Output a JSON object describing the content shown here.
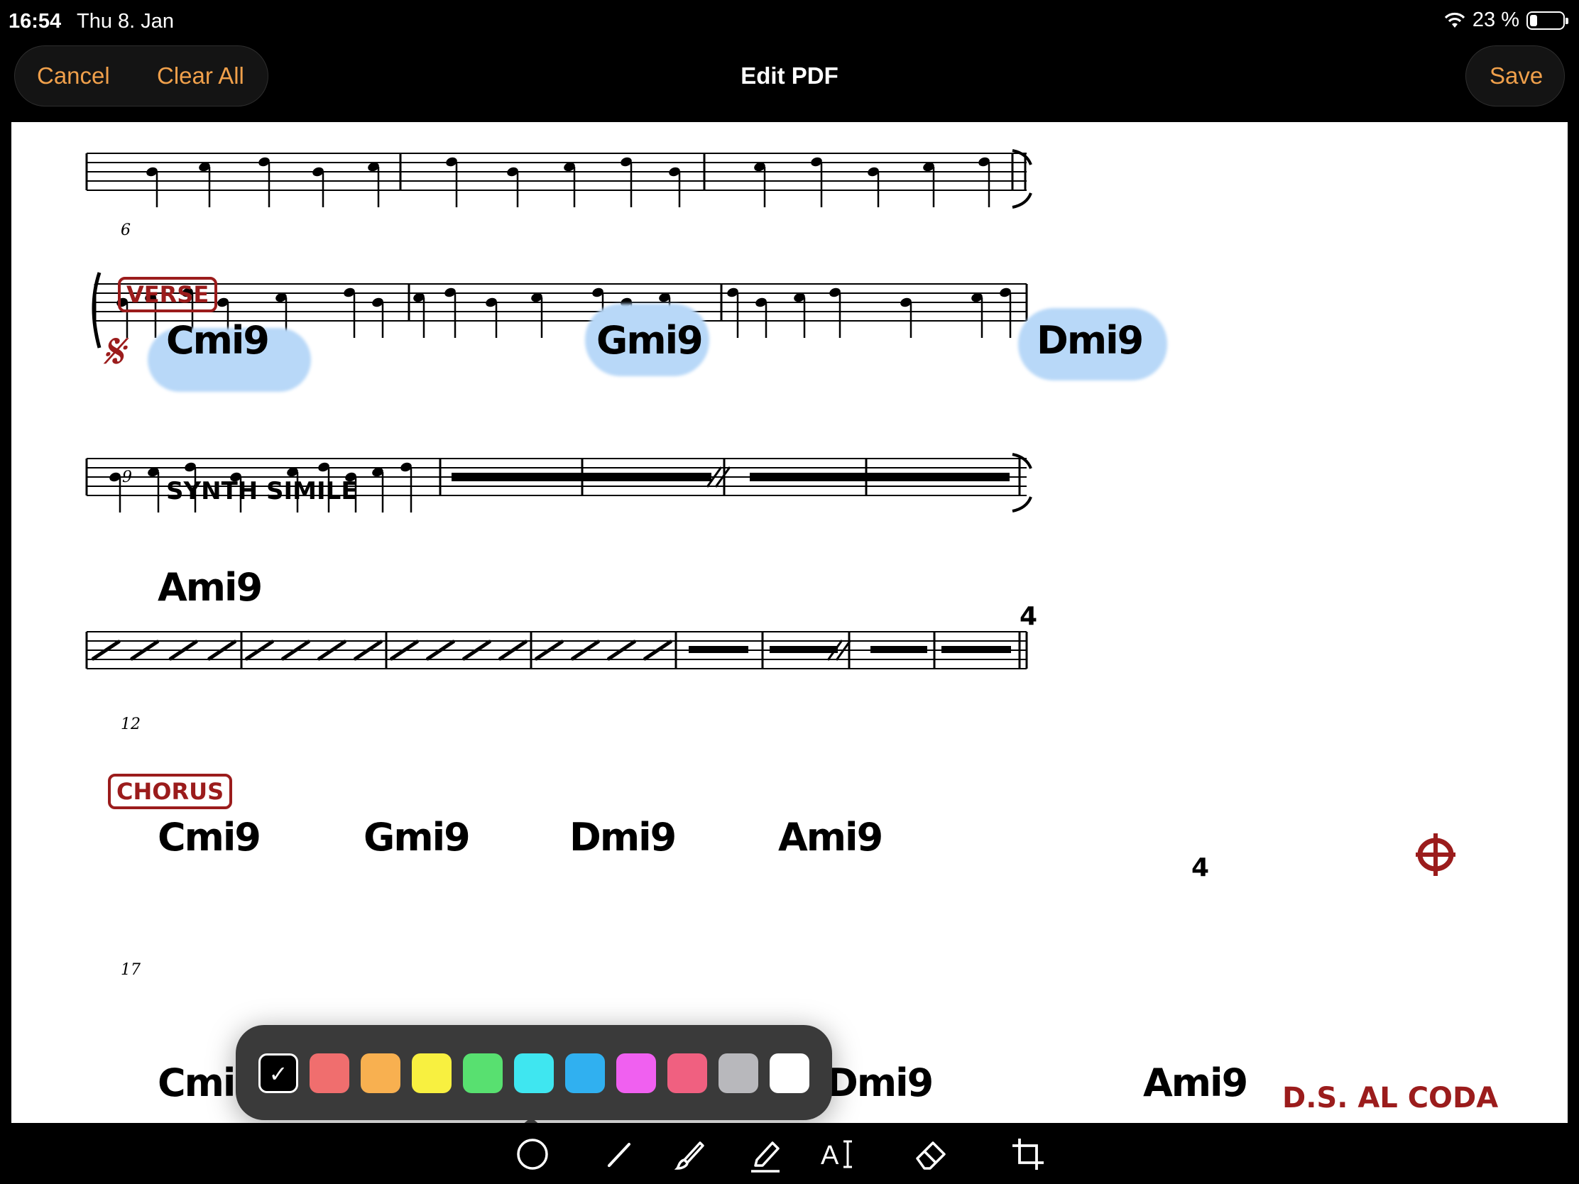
{
  "status": {
    "time": "16:54",
    "date": "Thu 8. Jan",
    "battery": "23 %"
  },
  "toolbar": {
    "cancel": "Cancel",
    "clear_all": "Clear All",
    "title": "Edit PDF",
    "save": "Save"
  },
  "sheet": {
    "measure_numbers": [
      "6",
      "9",
      "12",
      "17"
    ],
    "rehearsal": {
      "verse": "VERSE",
      "chorus": "CHORUS"
    },
    "instruction": "SYNTH SIMILE",
    "ds_al_coda": "D.S. AL CODA",
    "multirest_count": "4",
    "chords": {
      "verse": [
        "Cmi9",
        "Gmi9",
        "Dmi9"
      ],
      "line3": [
        "Ami9"
      ],
      "chorus": [
        "Cmi9",
        "Gmi9",
        "Dmi9",
        "Ami9"
      ],
      "bottom": [
        "Cmi9",
        "Dmi9",
        "Ami9"
      ]
    }
  },
  "palette": {
    "colors": [
      "#000000",
      "#f06e6e",
      "#f8b050",
      "#f8f040",
      "#58e070",
      "#3fe6f0",
      "#30b0f0",
      "#f060f0",
      "#f06080",
      "#b8b8bc",
      "#ffffff"
    ],
    "selected_index": 0,
    "check": "✓"
  },
  "tools": [
    "shape-tool",
    "pen-tool",
    "brush-tool",
    "highlighter-tool",
    "text-tool",
    "eraser-tool",
    "crop-tool"
  ],
  "accent_color": "#f0a04b"
}
